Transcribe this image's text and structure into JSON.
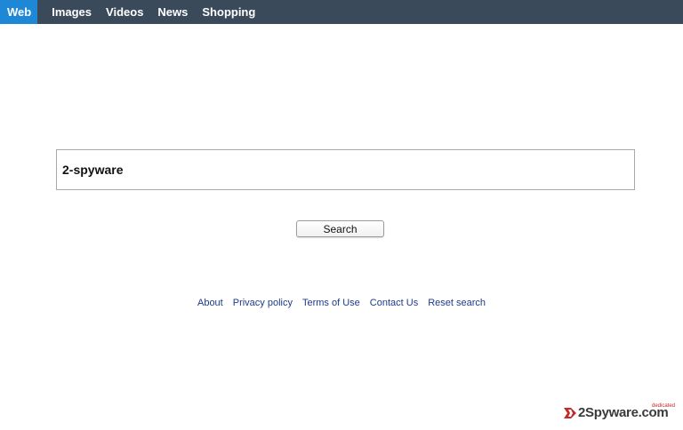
{
  "nav": {
    "tabs": [
      {
        "label": "Web",
        "active": true
      },
      {
        "label": "Images",
        "active": false
      },
      {
        "label": "Videos",
        "active": false
      },
      {
        "label": "News",
        "active": false
      },
      {
        "label": "Shopping",
        "active": false
      }
    ]
  },
  "search": {
    "value": "2-spyware",
    "button_label": "Search"
  },
  "footer": {
    "links": [
      {
        "label": "About"
      },
      {
        "label": "Privacy policy"
      },
      {
        "label": "Terms of Use"
      },
      {
        "label": "Contact Us"
      },
      {
        "label": "Reset search"
      }
    ]
  },
  "watermark": {
    "text": "2Spyware.com",
    "subtext": "dedicated"
  },
  "colors": {
    "navbar_bg": "#3b4a5a",
    "active_tab": "#1e88d6",
    "link": "#1f3a8a",
    "watermark_red": "#c62828"
  }
}
